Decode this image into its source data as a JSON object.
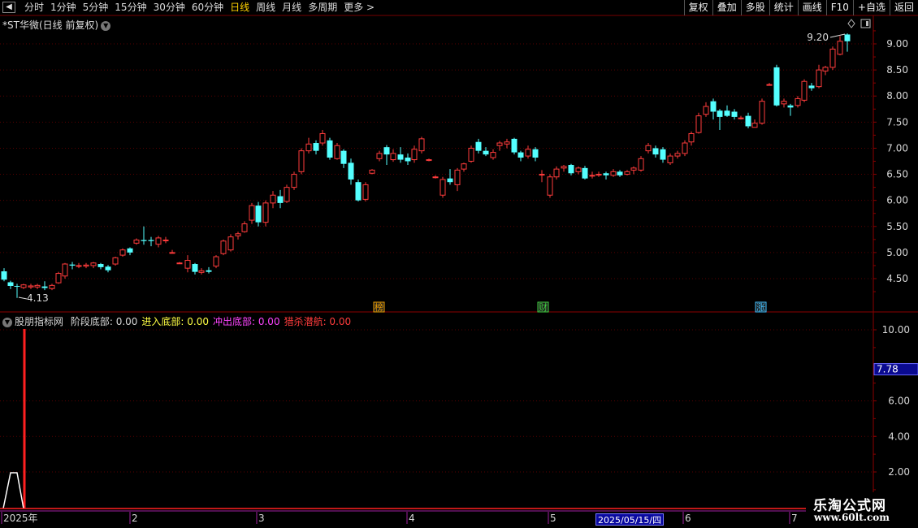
{
  "toolbar": {
    "back_icon": "back-arrow-icon",
    "periods": [
      "分时",
      "1分钟",
      "5分钟",
      "15分钟",
      "30分钟",
      "60分钟",
      "日线",
      "周线",
      "月线",
      "多周期",
      "更多 >"
    ],
    "active_period": "日线",
    "right_buttons": [
      "复权",
      "叠加",
      "多股",
      "统计",
      "画线",
      "F10",
      "+自选",
      "返回"
    ]
  },
  "chart": {
    "title": "*ST华微(日线 前复权)",
    "price_axis": [
      "9.00",
      "8.50",
      "8.00",
      "7.50",
      "7.00",
      "6.50",
      "6.00",
      "5.50",
      "5.00",
      "4.50"
    ],
    "high_label": "9.20",
    "low_label": "4.13",
    "event_tags": [
      "榜",
      "财",
      "涨"
    ],
    "colors": {
      "up": "#ff3c3c",
      "down": "#54ffff",
      "grid": "#5a0000",
      "axis": "#8b0000"
    }
  },
  "indicator": {
    "name": "股朋指标网",
    "items": [
      {
        "label": "阶段底部: 0.00",
        "color": "#d8d8d8"
      },
      {
        "label": "进入底部: 0.00",
        "color": "#ffff44"
      },
      {
        "label": "冲出底部: 0.00",
        "color": "#ff44ff"
      },
      {
        "label": "猎杀潜航: 0.00",
        "color": "#ff3c3c"
      }
    ],
    "axis": [
      "10.00",
      "6.00",
      "4.00",
      "2.00"
    ],
    "current_value": "7.78"
  },
  "date_axis": {
    "labels": [
      "2025年",
      "2",
      "3",
      "4",
      "5",
      "6",
      "7"
    ],
    "highlight": "2025/05/15/四"
  },
  "watermark": {
    "title": "乐淘公式网",
    "url": "www.60lt.com"
  }
}
